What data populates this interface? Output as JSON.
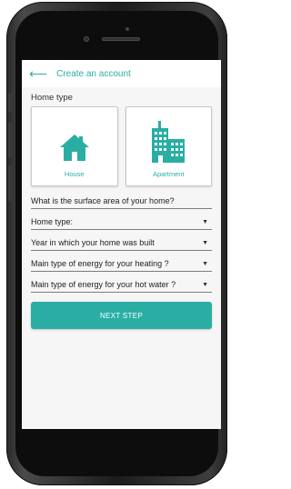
{
  "header": {
    "title": "Create an account",
    "back_icon": "arrow-left-icon"
  },
  "home_type_section": {
    "label": "Home type",
    "options": [
      {
        "label": "House",
        "icon": "house-icon"
      },
      {
        "label": "Apartment",
        "icon": "apartment-icon"
      }
    ]
  },
  "form": {
    "fields": [
      {
        "label": "What is the surface area of your home?",
        "has_caret": false
      },
      {
        "label": "Home type:",
        "has_caret": true
      },
      {
        "label": "Year in which your home was built",
        "has_caret": true
      },
      {
        "label": "Main type of energy for your heating ?",
        "has_caret": true
      },
      {
        "label": "Main type of energy for your hot water ?",
        "has_caret": true
      }
    ],
    "caret_symbol": "▼"
  },
  "actions": {
    "next_label": "NEXT STEP"
  },
  "colors": {
    "accent": "#2aaea4",
    "background": "#f6f6f6"
  }
}
